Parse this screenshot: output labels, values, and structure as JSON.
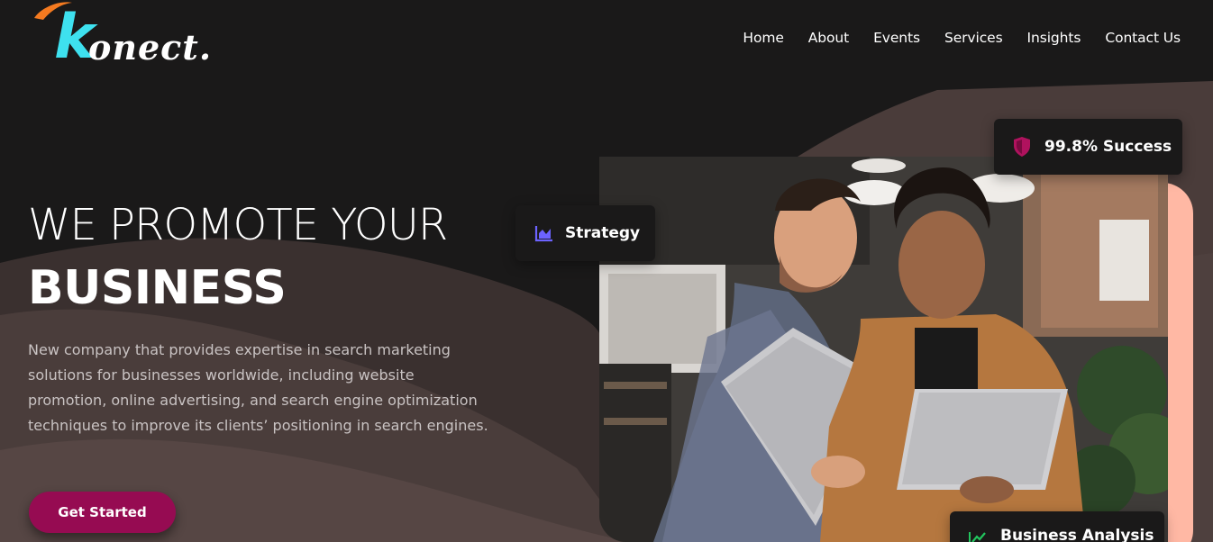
{
  "brand": {
    "logo_initial": "k",
    "logo_rest": "onect."
  },
  "nav": {
    "items": [
      {
        "label": "Home"
      },
      {
        "label": "About"
      },
      {
        "label": "Events"
      },
      {
        "label": "Services"
      },
      {
        "label": "Insights"
      },
      {
        "label": "Contact Us"
      }
    ]
  },
  "hero": {
    "title_line1": "WE PROMOTE YOUR",
    "title_line2": "BUSINESS",
    "description": "New company that provides expertise in search marketing solutions for businesses worldwide, including website promotion, online advertising, and search engine optimization techniques to improve its clients’ positioning in search engines.",
    "cta_label": "Get Started"
  },
  "badges": {
    "strategy": {
      "label": "Strategy",
      "icon": "area-chart-icon",
      "icon_color": "#6c63ff"
    },
    "success": {
      "label": "99.8% Success",
      "icon": "shield-icon",
      "icon_color": "#b0125e"
    },
    "analysis": {
      "label": "Business Analysis",
      "icon": "trend-line-icon",
      "icon_color": "#22c55e"
    }
  },
  "colors": {
    "background": "#1a1919",
    "wave": "#4a3c3a",
    "accent": "#960b52",
    "logo_cyan": "#3ee1ef",
    "logo_orange": "#f47a20",
    "photo_backdrop": "#ffb8a4"
  },
  "image": {
    "subject": "two-people-with-laptops-photo"
  }
}
